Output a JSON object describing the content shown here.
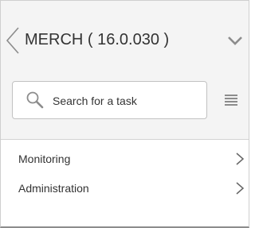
{
  "header": {
    "title": "MERCH ( 16.0.030 )",
    "back_icon": "chevron-left-icon",
    "expand_icon": "chevron-down-icon"
  },
  "search": {
    "placeholder": "Search for a task",
    "icon": "search-icon",
    "list_view_icon": "list-icon"
  },
  "menu": {
    "items": [
      {
        "label": "Monitoring",
        "icon": "chevron-right-icon"
      },
      {
        "label": "Administration",
        "icon": "chevron-right-icon"
      }
    ]
  },
  "colors": {
    "header_bg": "#f4f4f4",
    "text": "#333333",
    "icon_gray": "#8c8c8c"
  }
}
